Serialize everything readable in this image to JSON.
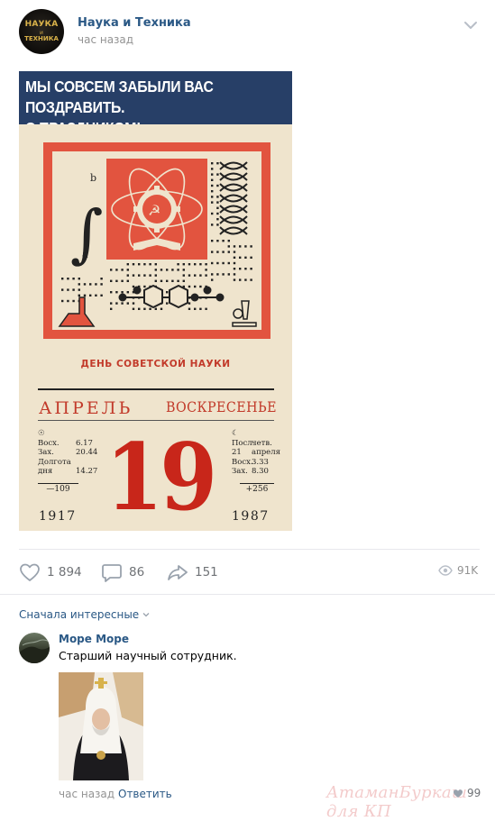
{
  "post": {
    "group": {
      "name": "Наука и Техника",
      "time": "час назад",
      "avatar_line1": "НАУКА",
      "avatar_line2": "и",
      "avatar_line3": "ТЕХНИКА"
    },
    "image": {
      "banner_text_line1": "МЫ СОВСЕМ ЗАБЫЛИ ВАС ПОЗДРАВИТЬ.",
      "banner_text_line2": "С ПРАЗДНИКОМ!",
      "calendar": {
        "caption": "ДЕНЬ СОВЕТСКОЙ НАУКИ",
        "month": "АПРЕЛЬ",
        "weekday": "ВОСКРЕСЕНЬЕ",
        "day": "19",
        "sun_symbol": "☉",
        "sun": [
          [
            "Восх.",
            "6.17"
          ],
          [
            "Зах.",
            "20.44"
          ],
          [
            "Долгота",
            ""
          ],
          [
            "дня",
            "14.27"
          ]
        ],
        "moon_symbol": "☾",
        "moon": [
          [
            "Посл.",
            "четв."
          ],
          [
            "21",
            "апреля"
          ],
          [
            "Восх.",
            "3.33"
          ],
          [
            "Зах.",
            "8.30"
          ]
        ],
        "left_delta": "—109",
        "right_delta": "+256",
        "year_left": "1917",
        "year_right": "1987"
      }
    },
    "actions": {
      "likes": "1 894",
      "comments": "86",
      "shares": "151",
      "views": "91K"
    },
    "colors": {
      "link": "#2a5885",
      "banner_bg": "#273f67",
      "calendar_red": "#c8261a"
    }
  },
  "comments": {
    "sort_label": "Сначала интересные",
    "items": [
      {
        "author": "Море Море",
        "text": "Старший научный сотрудник.",
        "time": "час назад",
        "reply_label": "Ответить",
        "likes": "99"
      }
    ]
  },
  "watermark": "АтаманБуркаш для КП"
}
